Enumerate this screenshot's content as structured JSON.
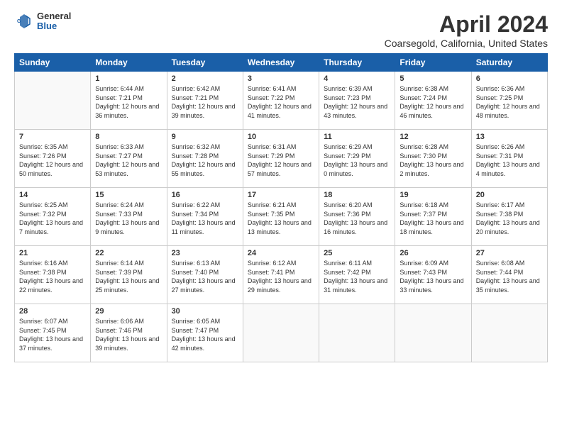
{
  "logo": {
    "general": "General",
    "blue": "Blue"
  },
  "title": "April 2024",
  "subtitle": "Coarsegold, California, United States",
  "days_of_week": [
    "Sunday",
    "Monday",
    "Tuesday",
    "Wednesday",
    "Thursday",
    "Friday",
    "Saturday"
  ],
  "weeks": [
    [
      {
        "day": "",
        "info": ""
      },
      {
        "day": "1",
        "info": "Sunrise: 6:44 AM\nSunset: 7:21 PM\nDaylight: 12 hours\nand 36 minutes."
      },
      {
        "day": "2",
        "info": "Sunrise: 6:42 AM\nSunset: 7:21 PM\nDaylight: 12 hours\nand 39 minutes."
      },
      {
        "day": "3",
        "info": "Sunrise: 6:41 AM\nSunset: 7:22 PM\nDaylight: 12 hours\nand 41 minutes."
      },
      {
        "day": "4",
        "info": "Sunrise: 6:39 AM\nSunset: 7:23 PM\nDaylight: 12 hours\nand 43 minutes."
      },
      {
        "day": "5",
        "info": "Sunrise: 6:38 AM\nSunset: 7:24 PM\nDaylight: 12 hours\nand 46 minutes."
      },
      {
        "day": "6",
        "info": "Sunrise: 6:36 AM\nSunset: 7:25 PM\nDaylight: 12 hours\nand 48 minutes."
      }
    ],
    [
      {
        "day": "7",
        "info": "Sunrise: 6:35 AM\nSunset: 7:26 PM\nDaylight: 12 hours\nand 50 minutes."
      },
      {
        "day": "8",
        "info": "Sunrise: 6:33 AM\nSunset: 7:27 PM\nDaylight: 12 hours\nand 53 minutes."
      },
      {
        "day": "9",
        "info": "Sunrise: 6:32 AM\nSunset: 7:28 PM\nDaylight: 12 hours\nand 55 minutes."
      },
      {
        "day": "10",
        "info": "Sunrise: 6:31 AM\nSunset: 7:29 PM\nDaylight: 12 hours\nand 57 minutes."
      },
      {
        "day": "11",
        "info": "Sunrise: 6:29 AM\nSunset: 7:29 PM\nDaylight: 13 hours\nand 0 minutes."
      },
      {
        "day": "12",
        "info": "Sunrise: 6:28 AM\nSunset: 7:30 PM\nDaylight: 13 hours\nand 2 minutes."
      },
      {
        "day": "13",
        "info": "Sunrise: 6:26 AM\nSunset: 7:31 PM\nDaylight: 13 hours\nand 4 minutes."
      }
    ],
    [
      {
        "day": "14",
        "info": "Sunrise: 6:25 AM\nSunset: 7:32 PM\nDaylight: 13 hours\nand 7 minutes."
      },
      {
        "day": "15",
        "info": "Sunrise: 6:24 AM\nSunset: 7:33 PM\nDaylight: 13 hours\nand 9 minutes."
      },
      {
        "day": "16",
        "info": "Sunrise: 6:22 AM\nSunset: 7:34 PM\nDaylight: 13 hours\nand 11 minutes."
      },
      {
        "day": "17",
        "info": "Sunrise: 6:21 AM\nSunset: 7:35 PM\nDaylight: 13 hours\nand 13 minutes."
      },
      {
        "day": "18",
        "info": "Sunrise: 6:20 AM\nSunset: 7:36 PM\nDaylight: 13 hours\nand 16 minutes."
      },
      {
        "day": "19",
        "info": "Sunrise: 6:18 AM\nSunset: 7:37 PM\nDaylight: 13 hours\nand 18 minutes."
      },
      {
        "day": "20",
        "info": "Sunrise: 6:17 AM\nSunset: 7:38 PM\nDaylight: 13 hours\nand 20 minutes."
      }
    ],
    [
      {
        "day": "21",
        "info": "Sunrise: 6:16 AM\nSunset: 7:38 PM\nDaylight: 13 hours\nand 22 minutes."
      },
      {
        "day": "22",
        "info": "Sunrise: 6:14 AM\nSunset: 7:39 PM\nDaylight: 13 hours\nand 25 minutes."
      },
      {
        "day": "23",
        "info": "Sunrise: 6:13 AM\nSunset: 7:40 PM\nDaylight: 13 hours\nand 27 minutes."
      },
      {
        "day": "24",
        "info": "Sunrise: 6:12 AM\nSunset: 7:41 PM\nDaylight: 13 hours\nand 29 minutes."
      },
      {
        "day": "25",
        "info": "Sunrise: 6:11 AM\nSunset: 7:42 PM\nDaylight: 13 hours\nand 31 minutes."
      },
      {
        "day": "26",
        "info": "Sunrise: 6:09 AM\nSunset: 7:43 PM\nDaylight: 13 hours\nand 33 minutes."
      },
      {
        "day": "27",
        "info": "Sunrise: 6:08 AM\nSunset: 7:44 PM\nDaylight: 13 hours\nand 35 minutes."
      }
    ],
    [
      {
        "day": "28",
        "info": "Sunrise: 6:07 AM\nSunset: 7:45 PM\nDaylight: 13 hours\nand 37 minutes."
      },
      {
        "day": "29",
        "info": "Sunrise: 6:06 AM\nSunset: 7:46 PM\nDaylight: 13 hours\nand 39 minutes."
      },
      {
        "day": "30",
        "info": "Sunrise: 6:05 AM\nSunset: 7:47 PM\nDaylight: 13 hours\nand 42 minutes."
      },
      {
        "day": "",
        "info": ""
      },
      {
        "day": "",
        "info": ""
      },
      {
        "day": "",
        "info": ""
      },
      {
        "day": "",
        "info": ""
      }
    ]
  ]
}
